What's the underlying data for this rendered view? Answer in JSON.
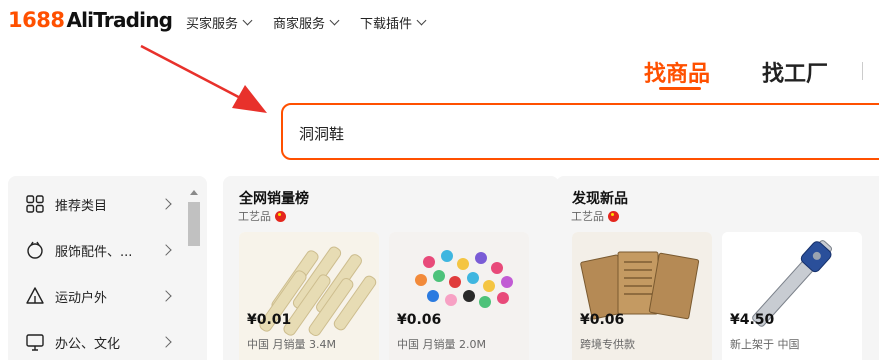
{
  "header": {
    "logo_number": "1688",
    "logo_brand": "AliTrading",
    "nav": [
      {
        "label": "买家服务"
      },
      {
        "label": "商家服务"
      },
      {
        "label": "下载插件"
      }
    ]
  },
  "search": {
    "tabs": [
      {
        "label": "找商品",
        "active": true
      },
      {
        "label": "找工厂",
        "active": false
      }
    ],
    "query": "洞洞鞋"
  },
  "sidebar": {
    "items": [
      {
        "label": "推荐类目",
        "icon": "grid-icon"
      },
      {
        "label": "服饰配件、...",
        "icon": "apparel-icon"
      },
      {
        "label": "运动户外",
        "icon": "tent-icon"
      },
      {
        "label": "办公、文化",
        "icon": "monitor-icon"
      }
    ]
  },
  "panels": [
    {
      "title": "全网销量榜",
      "subtitle": "工艺品",
      "products": [
        {
          "price": "¥0.01",
          "meta": "中国  月销量 3.4M"
        },
        {
          "price": "¥0.06",
          "meta": "中国  月销量 2.0M"
        }
      ]
    },
    {
      "title": "发现新品",
      "subtitle": "工艺品",
      "products": [
        {
          "price": "¥0.06",
          "meta": "跨境专供款"
        },
        {
          "price": "¥4.50",
          "meta": "新上架于 中国"
        }
      ]
    }
  ],
  "colors": {
    "accent": "#ff5000",
    "annotation_arrow": "#e8312b",
    "panel_bg": "#f5f5f5"
  }
}
